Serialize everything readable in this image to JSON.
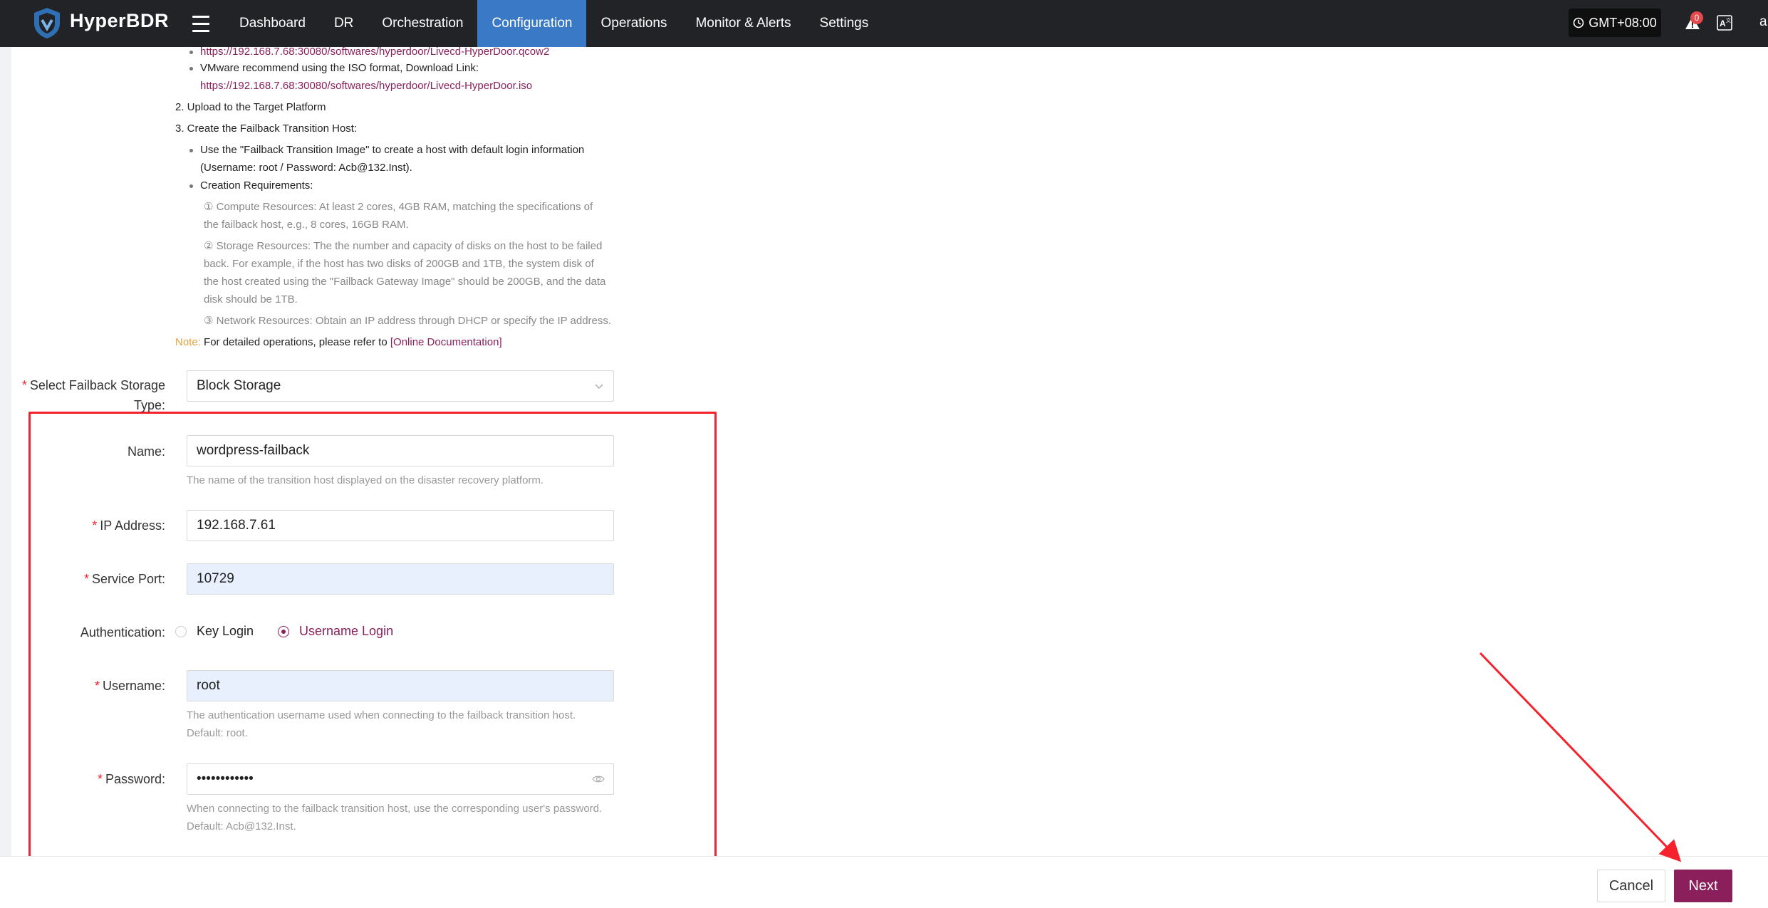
{
  "app": {
    "brand": "HyperBDR",
    "nav": [
      "Dashboard",
      "DR",
      "Orchestration",
      "Configuration",
      "Operations",
      "Monitor & Alerts",
      "Settings"
    ],
    "active_nav": "Configuration",
    "timezone": "GMT+08:00",
    "alert_count": "0",
    "user_initial": "a"
  },
  "doc": {
    "link_qcow2": "https://192.168.7.68:30080/softwares/hyperdoor/Livecd-HyperDoor.qcow2",
    "vmware_line": "VMware recommend using the ISO format, Download Link:",
    "link_iso": "https://192.168.7.68:30080/softwares/hyperdoor/Livecd-HyperDoor.iso",
    "step2": "2. Upload to the Target Platform",
    "step3": "3. Create the Failback Transition Host:",
    "bullet1_a": "Use the \"Failback Transition Image\" to create a host with default login information",
    "bullet1_b": "(Username: root / Password: Acb@132.Inst).",
    "bullet2": "Creation Requirements:",
    "req1_a": "① Compute Resources: At least 2 cores, 4GB RAM, matching the specifications of",
    "req1_b": "the failback host, e.g., 8 cores, 16GB RAM.",
    "req2_a": "② Storage Resources: The the number and capacity of disks on the host to be failed",
    "req2_b": "back. For example, if the host has two disks of 200GB and 1TB, the system disk of",
    "req2_c": "the host created using the \"Failback Gateway Image\" should be 200GB, and the data",
    "req2_d": "disk should be 1TB.",
    "req3": "③ Network Resources: Obtain an IP address through DHCP or specify the IP address.",
    "note_label": "Note:",
    "note_text": " For detailed operations, please refer to ",
    "note_link": "[Online Documentation]"
  },
  "form": {
    "storage_type_label_1": "Select Failback Storage",
    "storage_type_label_2": "Type:",
    "storage_type_value": "Block Storage",
    "name_label": "Name:",
    "name_value": "wordpress-failback",
    "name_hint": "The name of the transition host displayed on the disaster recovery platform.",
    "ip_label": "IP Address:",
    "ip_value": "192.168.7.61",
    "port_label": "Service Port:",
    "port_value": "10729",
    "auth_label": "Authentication:",
    "auth_options": [
      "Key Login",
      "Username Login"
    ],
    "auth_selected": "Username Login",
    "username_label": "Username:",
    "username_value": "root",
    "username_hint_1": "The authentication username used when connecting to the failback transition host.",
    "username_hint_2": "Default: root.",
    "password_label": "Password:",
    "password_value": "••••••••••••",
    "password_hint_1": "When connecting to the failback transition host, use the corresponding user's password.",
    "password_hint_2": "Default: Acb@132.Inst."
  },
  "footer": {
    "cancel": "Cancel",
    "next": "Next"
  },
  "colors": {
    "nav_bg": "#222326",
    "nav_active": "#3a79c5",
    "accent": "#8a1f5c",
    "annotation": "#f5222d"
  }
}
